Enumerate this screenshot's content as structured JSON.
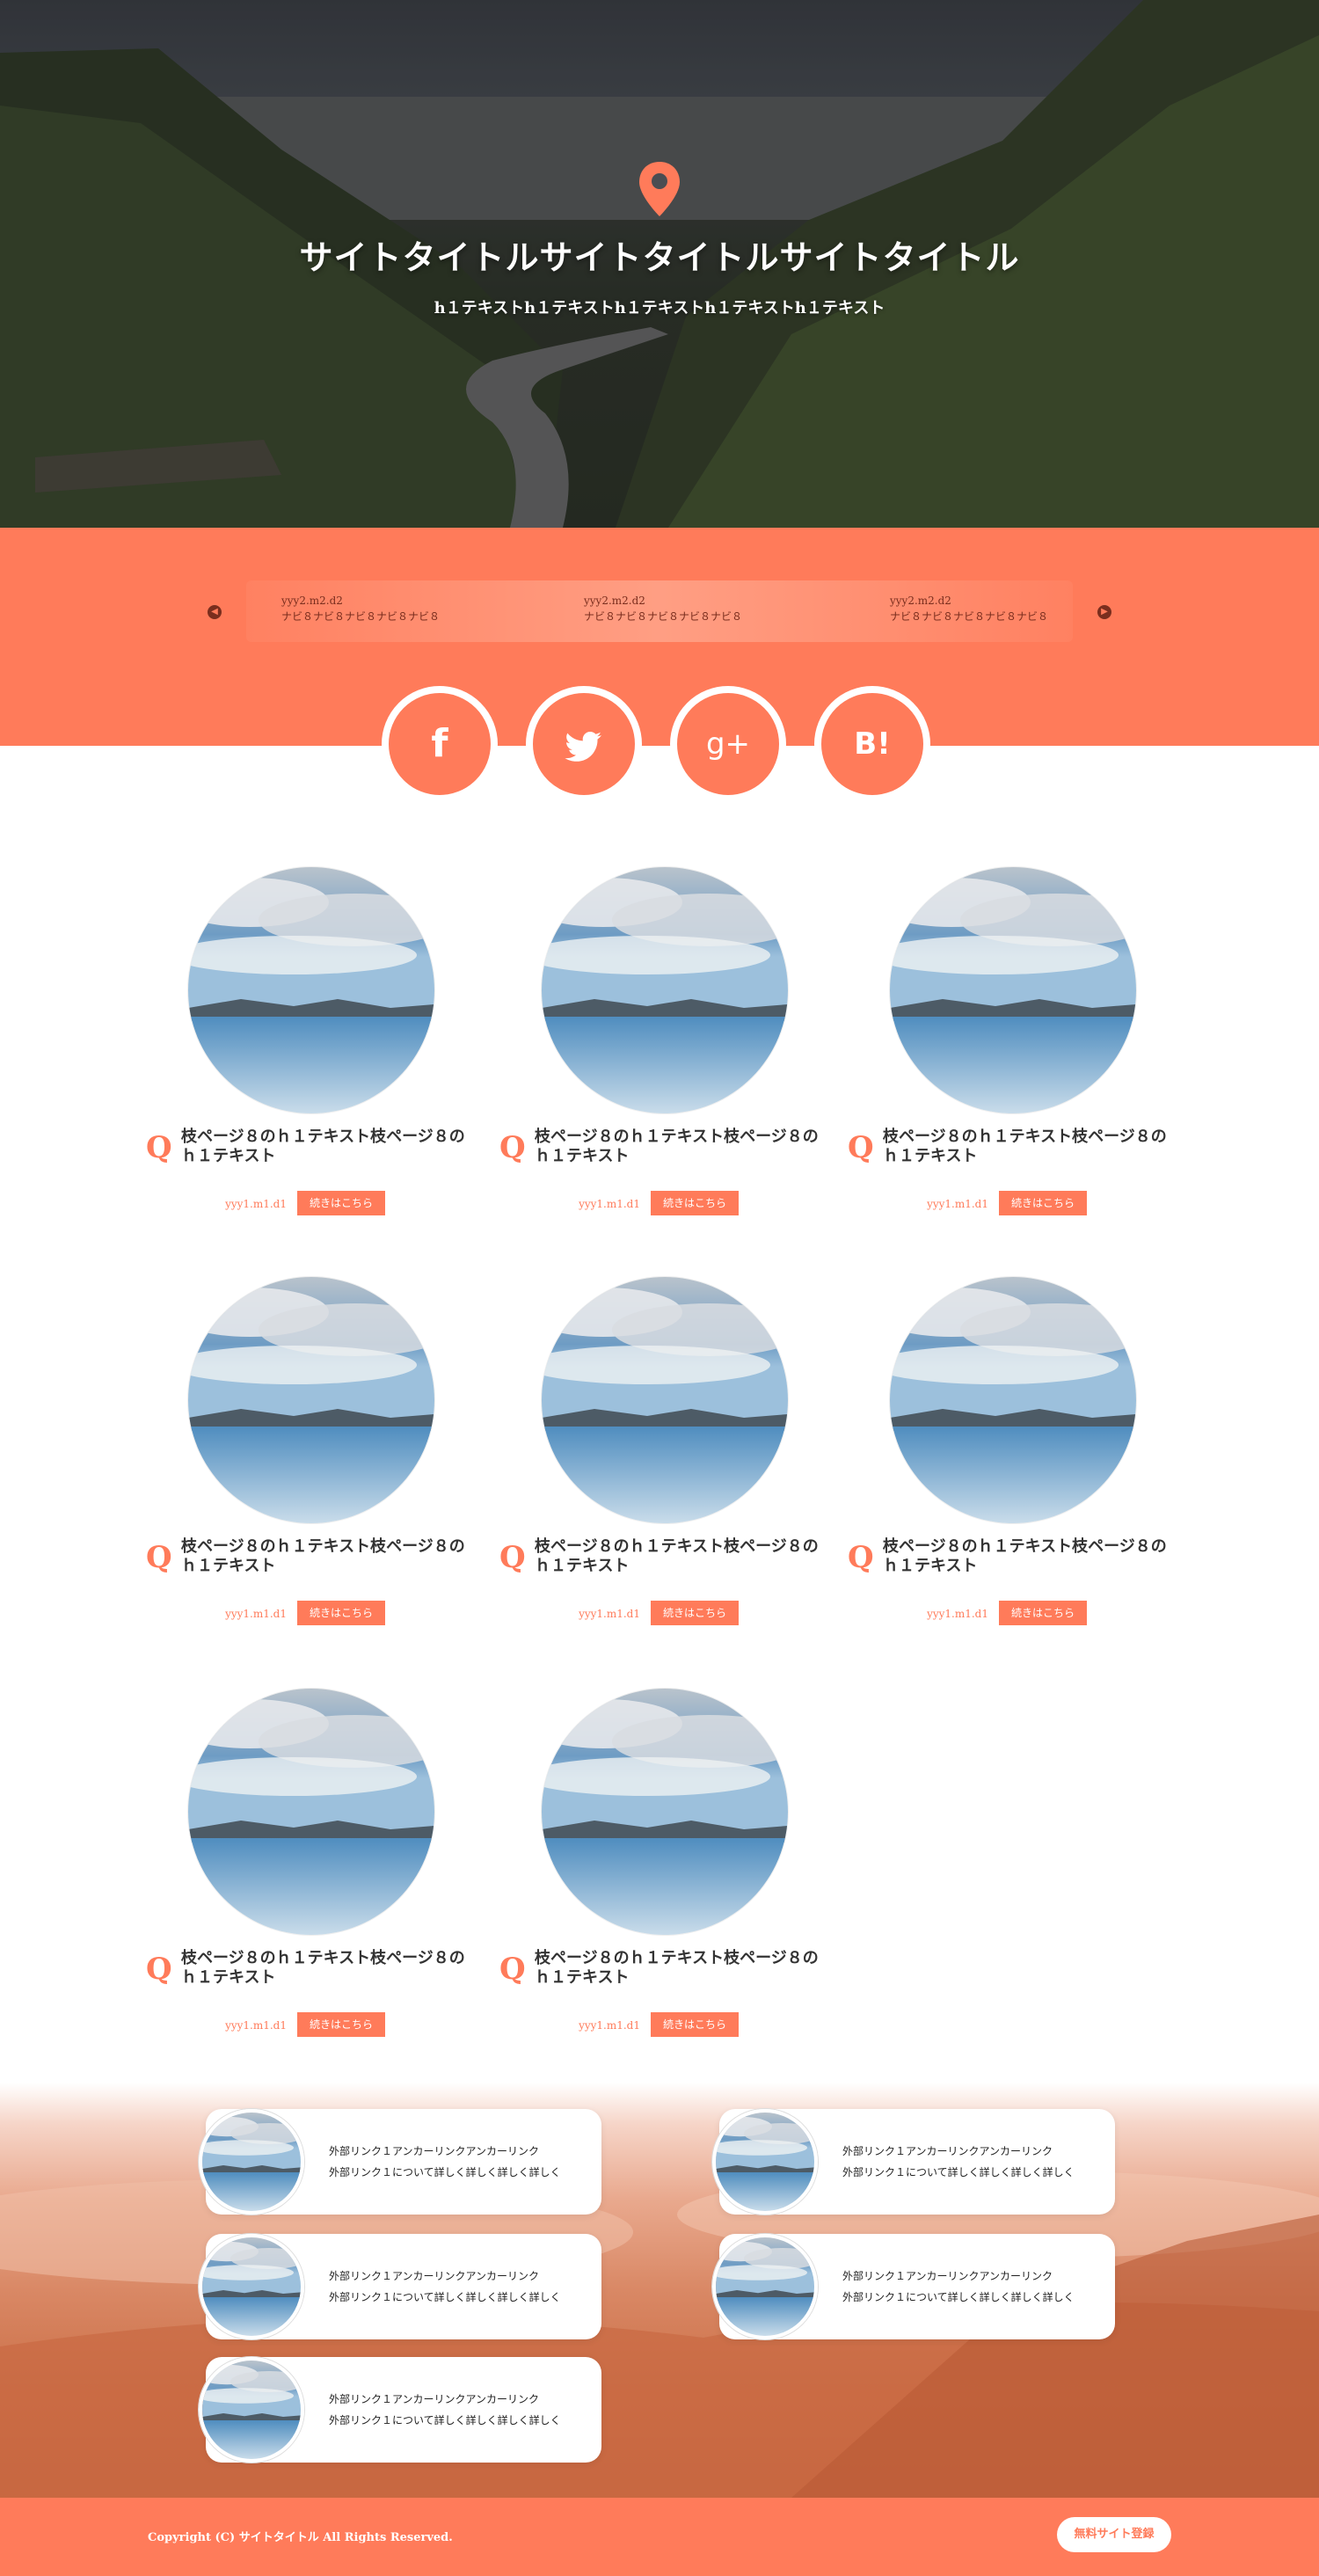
{
  "hero": {
    "title": "サイトタイトルサイトタイトルサイトタイトル",
    "subtitle": "h１テキストh１テキストh１テキストh１テキストh１テキスト",
    "pin_icon": "map-pin-icon"
  },
  "news": {
    "items": [
      {
        "date": "yyy2.m2.d2",
        "text": "ナビ８ナビ８ナビ８ナビ８ナビ８"
      },
      {
        "date": "yyy2.m2.d2",
        "text": "ナビ８ナビ８ナビ８ナビ８ナビ８"
      },
      {
        "date": "yyy2.m2.d2",
        "text": "ナビ８ナビ８ナビ８ナビ８ナビ８"
      }
    ]
  },
  "social": [
    {
      "label": "f",
      "icon": "facebook-icon"
    },
    {
      "label": "🐦",
      "icon": "twitter-icon"
    },
    {
      "label": "g+",
      "icon": "google-plus-icon"
    },
    {
      "label": "B!",
      "icon": "hatena-bookmark-icon"
    }
  ],
  "posts": [
    {
      "q": "Q",
      "title": "枝ページ８のｈ１テキスト枝ページ８のｈ１テキスト",
      "date": "yyy1.m1.d1",
      "button": "続きはこちら"
    },
    {
      "q": "Q",
      "title": "枝ページ８のｈ１テキスト枝ページ８のｈ１テキスト",
      "date": "yyy1.m1.d1",
      "button": "続きはこちら"
    },
    {
      "q": "Q",
      "title": "枝ページ８のｈ１テキスト枝ページ８のｈ１テキスト",
      "date": "yyy1.m1.d1",
      "button": "続きはこちら"
    },
    {
      "q": "Q",
      "title": "枝ページ８のｈ１テキスト枝ページ８のｈ１テキスト",
      "date": "yyy1.m1.d1",
      "button": "続きはこちら"
    },
    {
      "q": "Q",
      "title": "枝ページ８のｈ１テキスト枝ページ８のｈ１テキスト",
      "date": "yyy1.m1.d1",
      "button": "続きはこちら"
    },
    {
      "q": "Q",
      "title": "枝ページ８のｈ１テキスト枝ページ８のｈ１テキスト",
      "date": "yyy1.m1.d1",
      "button": "続きはこちら"
    },
    {
      "q": "Q",
      "title": "枝ページ８のｈ１テキスト枝ページ８のｈ１テキスト",
      "date": "yyy1.m1.d1",
      "button": "続きはこちら"
    },
    {
      "q": "Q",
      "title": "枝ページ８のｈ１テキスト枝ページ８のｈ１テキスト",
      "date": "yyy1.m1.d1",
      "button": "続きはこちら"
    }
  ],
  "links": [
    {
      "line1": "外部リンク１アンカーリンクアンカーリンク",
      "line2": "外部リンク１について詳しく詳しく詳しく詳しく"
    },
    {
      "line1": "外部リンク１アンカーリンクアンカーリンク",
      "line2": "外部リンク１について詳しく詳しく詳しく詳しく"
    },
    {
      "line1": "外部リンク１アンカーリンクアンカーリンク",
      "line2": "外部リンク１について詳しく詳しく詳しく詳しく"
    },
    {
      "line1": "外部リンク１アンカーリンクアンカーリンク",
      "line2": "外部リンク１について詳しく詳しく詳しく詳しく"
    },
    {
      "line1": "外部リンク１アンカーリンクアンカーリンク",
      "line2": "外部リンク１について詳しく詳しく詳しく詳しく"
    }
  ],
  "footer": {
    "copyright": "Copyright (C) サイトタイトル All Rights Reserved.",
    "signup": "無料サイト登録"
  },
  "colors": {
    "accent": "#ff7b5a",
    "dark": "#7a2e1e"
  }
}
